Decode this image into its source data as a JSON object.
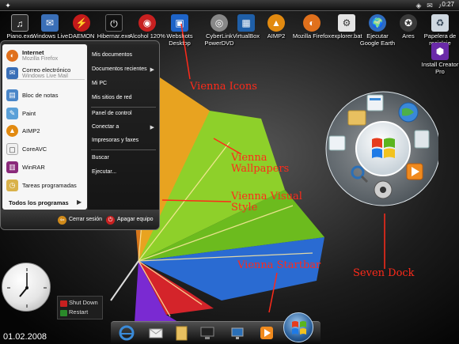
{
  "desktop_icons": [
    {
      "label": "Piano.exe",
      "icon": "piano-icon"
    },
    {
      "label": "Windows Live Mail",
      "icon": "mail-icon"
    },
    {
      "label": "DAEMON Tools",
      "icon": "daemon-tools-icon"
    },
    {
      "label": "Hibernar.exe",
      "icon": "hibernate-icon"
    },
    {
      "label": "Alcohol 120%",
      "icon": "alcohol-icon"
    },
    {
      "label": "Webshots Desktop",
      "icon": "webshots-icon"
    },
    {
      "label": "CyberLink PowerDVD",
      "icon": "powerdvd-icon"
    },
    {
      "label": "VirtualBox",
      "icon": "virtualbox-icon"
    },
    {
      "label": "AIMP2",
      "icon": "aimp2-icon"
    },
    {
      "label": "Mozilla Firefox",
      "icon": "firefox-icon"
    },
    {
      "label": "explorer.bat",
      "icon": "batch-file-icon"
    },
    {
      "label": "Ejecutar Google Earth",
      "icon": "google-earth-icon"
    },
    {
      "label": "Ares",
      "icon": "ares-icon"
    },
    {
      "label": "Papelera de reciclaje",
      "icon": "recycle-bin-icon"
    },
    {
      "label": "Install Creator Pro",
      "icon": "install-creator-icon"
    }
  ],
  "topbar": {
    "clock": "0:27"
  },
  "start_menu": {
    "pinned": [
      {
        "title": "Internet",
        "subtitle": "Mozilla Firefox"
      },
      {
        "title": "Correo electrónico",
        "subtitle": "Windows Live Mail"
      }
    ],
    "recent": [
      "Bloc de notas",
      "Paint",
      "AIMP2",
      "CoreAVC",
      "WinRAR",
      "Tareas programadas"
    ],
    "all_programs": "Todos los programas",
    "right": [
      "Mis documentos",
      "Documentos recientes",
      "Mi PC",
      "Mis sitios de red",
      "Panel de control",
      "Conectar a",
      "Impresoras y faxes",
      "Buscar",
      "Ejecutar..."
    ],
    "logoff": "Cerrar sesión",
    "shutdown": "Apagar equipo"
  },
  "annotations": {
    "icons": "Vienna Icons",
    "wallpapers": "Vienna Wallpapers",
    "visual_style": "Vienna Visual Style",
    "startbar": "Vienna Startbar",
    "dock": "Seven Dock"
  },
  "shutdown_widget": {
    "shutdown": "Shut Down",
    "restart": "Restart"
  },
  "date": "01.02.2008",
  "colors": {
    "annotation": "#ff2a1a"
  }
}
